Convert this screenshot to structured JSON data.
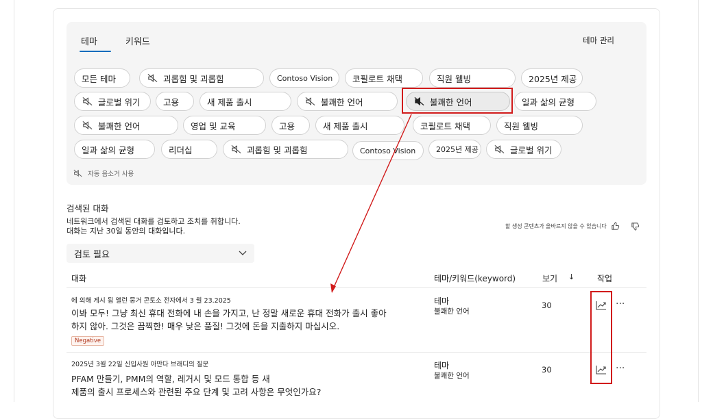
{
  "tabs": {
    "themes": "테마",
    "keywords": "키워드",
    "manage": "테마 관리"
  },
  "chips": [
    {
      "label": "모든 테마",
      "muted": false
    },
    {
      "label": "괴롭힘 및 괴롭힘",
      "muted": true
    },
    {
      "label": "Contoso Vision",
      "muted": false
    },
    {
      "label": "코필로트 채택",
      "muted": false
    },
    {
      "label": "직원 웰빙",
      "muted": false
    },
    {
      "label": "2025년 제공",
      "muted": false
    },
    {
      "label": "글로벌 위기",
      "muted": true
    },
    {
      "label": "고용",
      "muted": false
    },
    {
      "label": "새 제품 출시",
      "muted": false
    },
    {
      "label": "불쾌한 언어",
      "muted": true
    },
    {
      "label": "불쾌한 언어",
      "muted": true
    },
    {
      "label": "일과 삶의 균형",
      "muted": false
    },
    {
      "label": "불쾌한 언어",
      "muted": true
    },
    {
      "label": "영업 및 교육",
      "muted": false
    },
    {
      "label": "고용",
      "muted": false
    },
    {
      "label": "새 제품 출시",
      "muted": false
    },
    {
      "label": "코필로트 채택",
      "muted": false
    },
    {
      "label": "직원 웰빙",
      "muted": false
    },
    {
      "label": "일과 삶의 균형",
      "muted": false
    },
    {
      "label": "리더십",
      "muted": false
    },
    {
      "label": "괴롭힘 및 괴롭힘",
      "muted": true
    },
    {
      "label": "Contoso Vision",
      "muted": false
    },
    {
      "label": "2025년 제공",
      "muted": false
    },
    {
      "label": "글로벌 위기",
      "muted": true
    }
  ],
  "auto_remove": "자동 음소거 사용",
  "section": {
    "title": "검색된 대화",
    "desc1": "네트워크에서 검색된 대화를 검토하고 조치를 취합니다.",
    "desc2": "대화는 지난 30일 동안의 대화입니다.",
    "feedback": "할 생성 콘텐츠가 올바르지 않을 수 있습니다"
  },
  "filter": {
    "selected": "검토 필요"
  },
  "table": {
    "headers": {
      "conversation": "대화",
      "theme": "테마/키워드(keyword)",
      "views": "보기",
      "sort": "↓",
      "actions": "작업"
    },
    "rows": [
      {
        "meta": "에 의해 게시 됨 앨런 뭉거 콘토소 전자에서 3 월 23.2025",
        "line1": "이봐 모두! 그냥 최신 휴대 전화에 내 손을 가지고, 난 정말 새로운 휴대 전화가 출시 좋아",
        "line2": "하지 않아. 그것은 끔찍한! 매우 낮은 품질! 그것에 돈을 지출하지 마십시오.",
        "badge": "Negative",
        "theme_label": "테마",
        "theme_value": "불쾌한 언어",
        "views": "30",
        "more": "···"
      },
      {
        "meta": "2025년 3월 22일 신입사원 아만다 브래디의 질문",
        "line1": "PFAM 만들기, PMM의 역할, 레거시 및 모드 통합 등 새",
        "line2": "제품의 출시 프로세스와 관련된 주요 단계 및 고려 사항은 무엇인가요?",
        "theme_label": "테마",
        "theme_value": "불쾌한 언어",
        "views": "30",
        "more": "···"
      }
    ]
  },
  "colors": {
    "accent": "#0f6cbd",
    "annotation": "#d11b1b",
    "negative": "#b1371d"
  }
}
